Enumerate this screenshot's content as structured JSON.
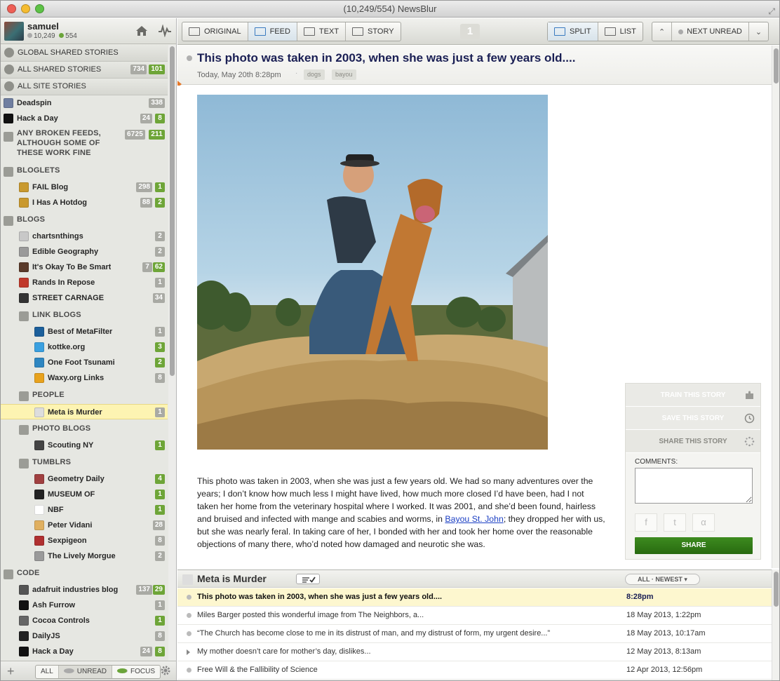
{
  "window": {
    "title": "(10,249/554) NewsBlur"
  },
  "user": {
    "name": "samuel",
    "neutral_count": "10,249",
    "positive_count": "554"
  },
  "sidebar": {
    "special": [
      {
        "label": "GLOBAL SHARED STORIES",
        "neutral": "",
        "positive": "",
        "icon": "global-icon"
      },
      {
        "label": "ALL SHARED STORIES",
        "neutral": "734",
        "positive": "101",
        "icon": "people-icon"
      },
      {
        "label": "ALL SITE STORIES",
        "neutral": "",
        "positive": "",
        "icon": "stack-icon"
      }
    ],
    "items": [
      {
        "type": "feed",
        "depth": 0,
        "label": "Deadspin",
        "neutral": "338",
        "positive": "",
        "color": "#6f7ea0"
      },
      {
        "type": "feed",
        "depth": 0,
        "label": "Hack a Day",
        "neutral": "24",
        "positive": "8",
        "color": "#111111"
      },
      {
        "type": "folder",
        "depth": 0,
        "label": "ANY BROKEN FEEDS, ALTHOUGH SOME OF THESE WORK FINE",
        "lines": [
          "ANY BROKEN FEEDS,",
          "ALTHOUGH SOME OF",
          "THESE WORK FINE"
        ],
        "neutral": "6725",
        "positive": "211"
      },
      {
        "type": "folder",
        "depth": 0,
        "label": "BLOGLETS",
        "neutral": "",
        "positive": ""
      },
      {
        "type": "feed",
        "depth": 1,
        "label": "FAIL Blog",
        "neutral": "298",
        "positive": "1",
        "color": "#c9992e"
      },
      {
        "type": "feed",
        "depth": 1,
        "label": "I Has A Hotdog",
        "neutral": "88",
        "positive": "2",
        "color": "#c9992e"
      },
      {
        "type": "folder",
        "depth": 0,
        "label": "BLOGS",
        "neutral": "",
        "positive": ""
      },
      {
        "type": "feed",
        "depth": 1,
        "label": "chartsnthings",
        "neutral": "2",
        "positive": "",
        "color": "#c8c8c8"
      },
      {
        "type": "feed",
        "depth": 1,
        "label": "Edible Geography",
        "neutral": "2",
        "positive": "",
        "color": "#9a9a9a"
      },
      {
        "type": "feed",
        "depth": 1,
        "label": "It's Okay To Be Smart",
        "neutral": "7",
        "positive": "62",
        "color": "#5a3a2a"
      },
      {
        "type": "feed",
        "depth": 1,
        "label": "Rands In Repose",
        "neutral": "1",
        "positive": "",
        "color": "#c0392b"
      },
      {
        "type": "feed",
        "depth": 1,
        "label": "STREET CARNAGE",
        "neutral": "34",
        "positive": "",
        "color": "#333333"
      },
      {
        "type": "folder",
        "depth": 1,
        "label": "LINK BLOGS",
        "neutral": "",
        "positive": ""
      },
      {
        "type": "feed",
        "depth": 2,
        "label": "Best of MetaFilter",
        "neutral": "1",
        "positive": "",
        "color": "#1c5f9b"
      },
      {
        "type": "feed",
        "depth": 2,
        "label": "kottke.org",
        "neutral": "",
        "positive": "3",
        "color": "#3aa0e0"
      },
      {
        "type": "feed",
        "depth": 2,
        "label": "One Foot Tsunami",
        "neutral": "",
        "positive": "2",
        "color": "#2e86c1"
      },
      {
        "type": "feed",
        "depth": 2,
        "label": "Waxy.org Links",
        "neutral": "8",
        "positive": "",
        "color": "#e8a21d"
      },
      {
        "type": "folder",
        "depth": 1,
        "label": "PEOPLE",
        "neutral": "",
        "positive": ""
      },
      {
        "type": "feed",
        "depth": 2,
        "label": "Meta is Murder",
        "neutral": "1",
        "positive": "",
        "color": "#dddddd",
        "selected": true
      },
      {
        "type": "folder",
        "depth": 1,
        "label": "PHOTO BLOGS",
        "neutral": "",
        "positive": ""
      },
      {
        "type": "feed",
        "depth": 2,
        "label": "Scouting NY",
        "neutral": "",
        "positive": "1",
        "color": "#444444"
      },
      {
        "type": "folder",
        "depth": 1,
        "label": "TUMBLRS",
        "neutral": "",
        "positive": ""
      },
      {
        "type": "feed",
        "depth": 2,
        "label": "Geometry Daily",
        "neutral": "",
        "positive": "4",
        "color": "#a04040"
      },
      {
        "type": "feed",
        "depth": 2,
        "label": "MUSEUM OF",
        "neutral": "",
        "positive": "1",
        "color": "#222222"
      },
      {
        "type": "feed",
        "depth": 2,
        "label": "NBF",
        "neutral": "",
        "positive": "1",
        "color": "#ffffff"
      },
      {
        "type": "feed",
        "depth": 2,
        "label": "Peter Vidani",
        "neutral": "28",
        "positive": "",
        "color": "#e0b060"
      },
      {
        "type": "feed",
        "depth": 2,
        "label": "Sexpigeon",
        "neutral": "8",
        "positive": "",
        "color": "#b03030"
      },
      {
        "type": "feed",
        "depth": 2,
        "label": "The Lively Morgue",
        "neutral": "2",
        "positive": "",
        "color": "#9a9a9a"
      },
      {
        "type": "folder",
        "depth": 0,
        "label": "CODE",
        "neutral": "",
        "positive": ""
      },
      {
        "type": "feed",
        "depth": 1,
        "label": "adafruit industries blog",
        "neutral": "137",
        "positive": "29",
        "color": "#555555"
      },
      {
        "type": "feed",
        "depth": 1,
        "label": "Ash Furrow",
        "neutral": "1",
        "positive": "",
        "color": "#111111"
      },
      {
        "type": "feed",
        "depth": 1,
        "label": "Cocoa Controls",
        "neutral": "",
        "positive": "1",
        "color": "#666666"
      },
      {
        "type": "feed",
        "depth": 1,
        "label": "DailyJS",
        "neutral": "8",
        "positive": "",
        "color": "#222222"
      },
      {
        "type": "feed",
        "depth": 1,
        "label": "Hack a Day",
        "neutral": "24",
        "positive": "8",
        "color": "#111111"
      }
    ],
    "footer": {
      "filters": [
        "ALL",
        "UNREAD",
        "FOCUS"
      ],
      "active": "UNREAD"
    }
  },
  "toolbar": {
    "views": [
      {
        "label": "ORIGINAL",
        "icon": "original-view-icon"
      },
      {
        "label": "FEED",
        "icon": "feed-view-icon",
        "active": true
      },
      {
        "label": "TEXT",
        "icon": "text-view-icon"
      },
      {
        "label": "STORY",
        "icon": "story-view-icon"
      }
    ],
    "page_indicator": "1",
    "layouts": [
      {
        "label": "SPLIT",
        "icon": "split-layout-icon",
        "active": true
      },
      {
        "label": "LIST",
        "icon": "list-layout-icon"
      }
    ],
    "next_unread": "NEXT UNREAD"
  },
  "story": {
    "title": "This photo was taken in 2003, when she was just a few years old....",
    "date": "Today, May 20th 8:28pm",
    "tags": [
      "dogs",
      "bayou"
    ],
    "body_parts": [
      "This photo was taken in 2003, when she was just a few years old. We had so many adventures over the years; I don’t know how much less I might have lived, how much more closed I’d have been, had I not taken her home from the veterinary hospital where I worked. It was 2001, and she’d been found, hairless and bruised and infected with mange and scabies and worms, in ",
      "Bayou St. John",
      "; they dropped her with us, but she was nearly feral. In taking care of her, I bonded with her and took her home over the reasonable objections of many there, who’d noted how damaged and neurotic she was."
    ]
  },
  "share_panel": {
    "train": "TRAIN THIS STORY",
    "save": "SAVE THIS STORY",
    "share": "SHARE THIS STORY",
    "comments_label": "COMMENTS:",
    "comments_value": "",
    "social": [
      "f",
      "t",
      "α"
    ],
    "share_button": "SHARE"
  },
  "story_list": {
    "feed_title": "Meta is Murder",
    "order": "ALL · NEWEST",
    "stories": [
      {
        "title": "This photo was taken in 2003, when she was just a few years old....",
        "date": "8:28pm",
        "selected": true
      },
      {
        "title": "Miles Barger posted this wonderful image from The Neighbors, a...",
        "date": "18 May 2013, 1:22pm"
      },
      {
        "title": "“The Church has become close to me in its distrust of man, and my distrust of form, my urgent desire...”",
        "date": "18 May 2013, 10:17am"
      },
      {
        "title": "My mother doesn’t care for mother’s day, dislikes...",
        "date": "12 May 2013, 8:13am",
        "arrow": true
      },
      {
        "title": "Free Will & the Fallibility of Science",
        "date": "12 Apr 2013, 12:56pm"
      }
    ]
  }
}
